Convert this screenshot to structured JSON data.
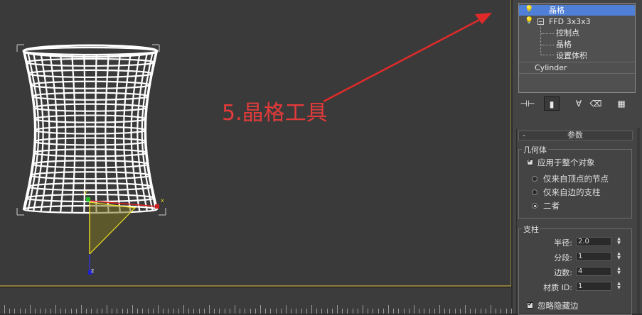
{
  "annotation": {
    "text": "5.晶格工具",
    "color": "#e23a3a"
  },
  "modifier_stack": {
    "items": [
      {
        "label": "晶格",
        "selected": true
      },
      {
        "label": "FFD 3x3x3"
      },
      {
        "label": "控制点"
      },
      {
        "label": "晶格"
      },
      {
        "label": "设置体积"
      },
      {
        "label": "Cylinder"
      }
    ]
  },
  "toolbar": {
    "icons": [
      "pin-stack-icon",
      "show-end-result-icon",
      "make-unique-icon",
      "remove-modifier-icon",
      "configure-modifier-sets-icon"
    ]
  },
  "params": {
    "rollout_title": "参数",
    "collapse_glyph": "-",
    "geometry": {
      "title": "几何体",
      "apply_whole": {
        "label": "应用于整个对象",
        "checked": true
      },
      "options": [
        {
          "label": "仅来自顶点的节点",
          "selected": false
        },
        {
          "label": "仅来自边的支柱",
          "selected": false
        },
        {
          "label": "二者",
          "selected": true
        }
      ]
    },
    "struts": {
      "title": "支柱",
      "fields": [
        {
          "label": "半径:",
          "value": "2.0"
        },
        {
          "label": "分段:",
          "value": "1"
        },
        {
          "label": "边数:",
          "value": "4"
        },
        {
          "label": "材质 ID:",
          "value": "1"
        }
      ],
      "ignore_hidden": {
        "label": "忽略隐藏边",
        "checked": true
      }
    }
  },
  "colors": {
    "selection": "#4f7fd6",
    "viewport_bg": "#3a3a3a",
    "wireframe": "#ffffff",
    "gizmo": "#f0e020",
    "arrow": "#e02a2a"
  }
}
